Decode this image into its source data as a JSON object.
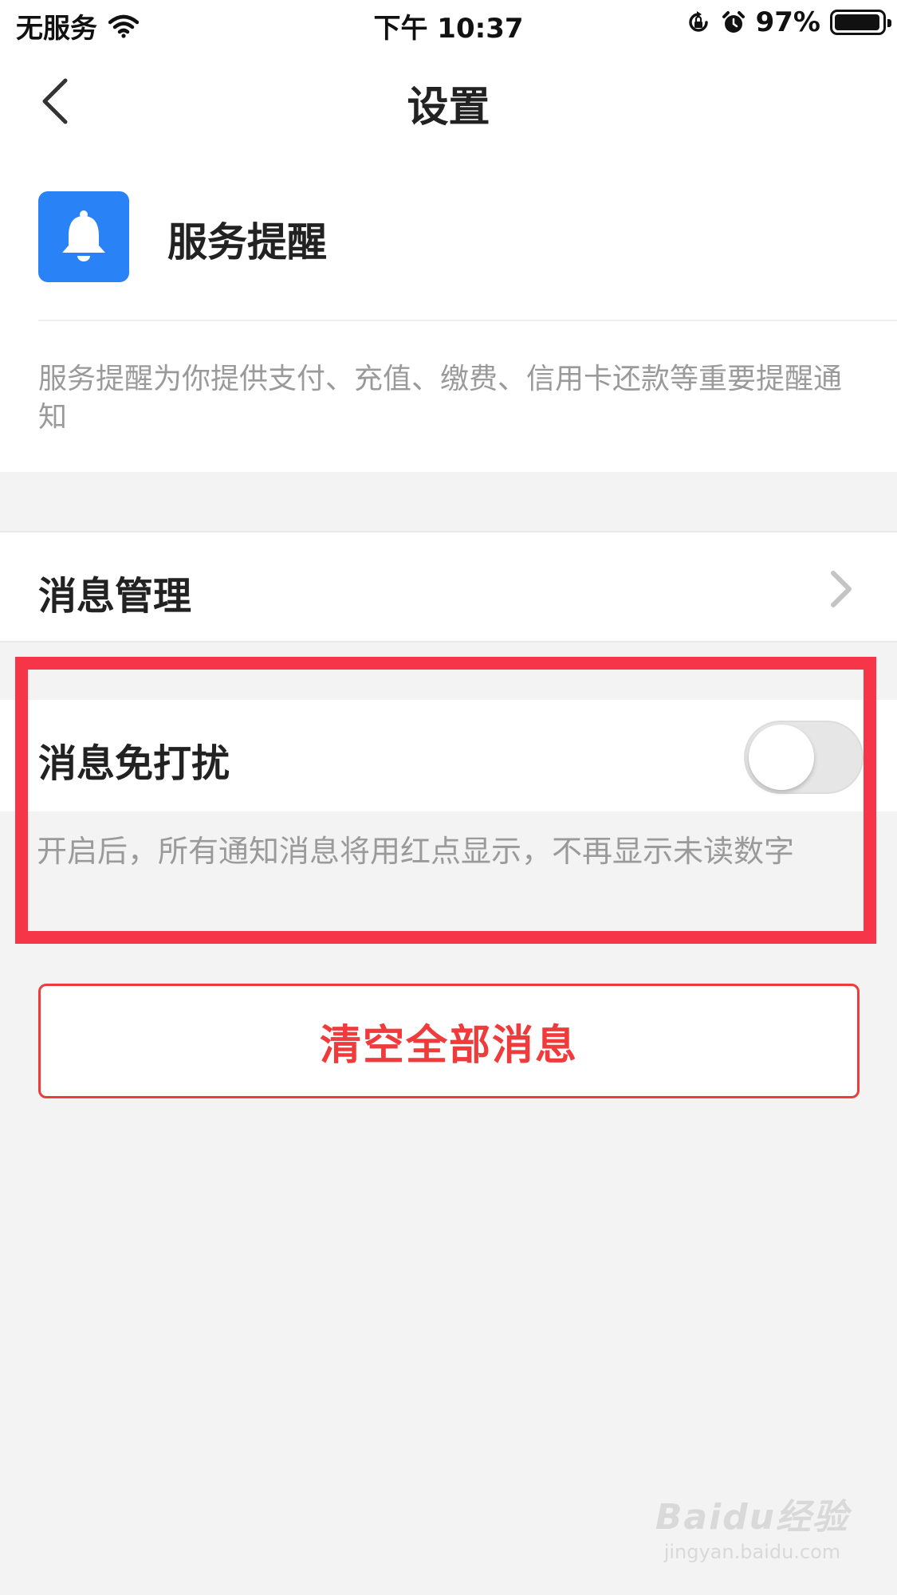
{
  "status_bar": {
    "carrier": "无服务",
    "time": "下午 10:37",
    "battery_percent": "97%",
    "battery_level": 0.97,
    "icons": [
      "wifi-icon",
      "rotation-lock-icon",
      "alarm-icon",
      "battery-icon"
    ]
  },
  "nav": {
    "title": "设置",
    "back_icon": "chevron-left-icon"
  },
  "service": {
    "icon": "bell-icon",
    "icon_color": "#2a82f7",
    "name": "服务提醒",
    "description": "服务提醒为你提供支付、充值、缴费、信用卡还款等重要提醒通知"
  },
  "settings": {
    "manage_label": "消息管理",
    "manage_icon": "chevron-right-icon",
    "dnd_label": "消息免打扰",
    "dnd_enabled": false,
    "dnd_description": "开启后，所有通知消息将用红点显示，不再显示未读数字"
  },
  "actions": {
    "clear_label": "清空全部消息",
    "clear_color": "#ef3b3b"
  },
  "annotation": {
    "highlight_color": "#f73548"
  },
  "watermark": {
    "main": "Baidu经验",
    "sub": "jingyan.baidu.com"
  }
}
